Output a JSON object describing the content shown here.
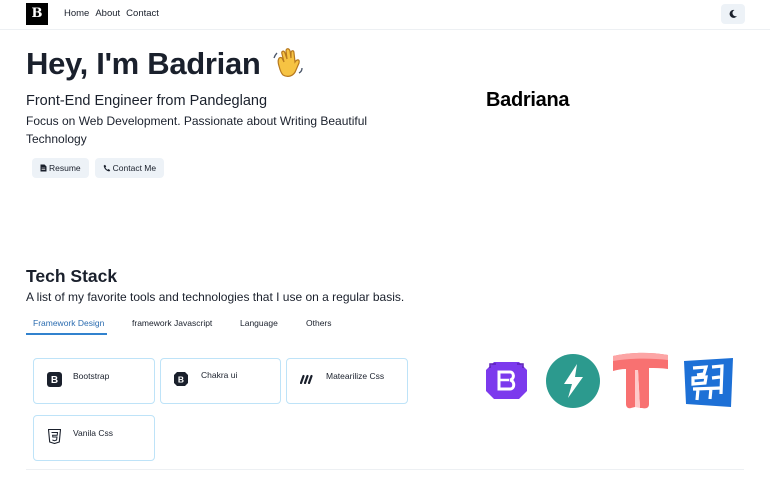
{
  "nav": {
    "logo_text": "B",
    "links": [
      "Home",
      "About",
      "Contact"
    ],
    "theme_toggle_icon": "moon-icon"
  },
  "hero": {
    "title": "Hey, I'm Badrian",
    "wave_icon": "waving-hand-icon",
    "subtitle": "Front-End Engineer from Pandeglang",
    "description": "Focus on Web Development. Passionate about Writing Beautiful Technology",
    "buttons": [
      {
        "label": "Resume",
        "icon": "document-icon"
      },
      {
        "label": "Contact Me",
        "icon": "phone-icon"
      }
    ],
    "brand": "Badriana"
  },
  "tech": {
    "title": "Tech Stack",
    "description": "A list of my favorite tools and technologies that I use on a regular basis.",
    "tabs": [
      "Framework Design",
      "framework Javascript",
      "Language",
      "Others"
    ],
    "active_tab": 0,
    "cards": [
      {
        "label": "Bootstrap",
        "icon": "bootstrap-icon"
      },
      {
        "label": "Chakra ui",
        "icon": "chakra-ui-icon"
      },
      {
        "label": "Matearilize Css",
        "icon": "materialize-icon"
      },
      {
        "label": "Vanila Css",
        "icon": "css3-icon"
      }
    ],
    "logos": [
      "bootstrap-logo",
      "chakra-ui-logo",
      "tailwind-logo",
      "materialize-logo"
    ]
  },
  "colors": {
    "accent": "#3182ce",
    "card_border": "#bee3f8",
    "button_bg": "#edf2f7",
    "bootstrap_purple": "#7952b3",
    "chakra_teal": "#319795",
    "tailwind_red": "#f56565",
    "materialize_blue": "#0d6efd"
  }
}
